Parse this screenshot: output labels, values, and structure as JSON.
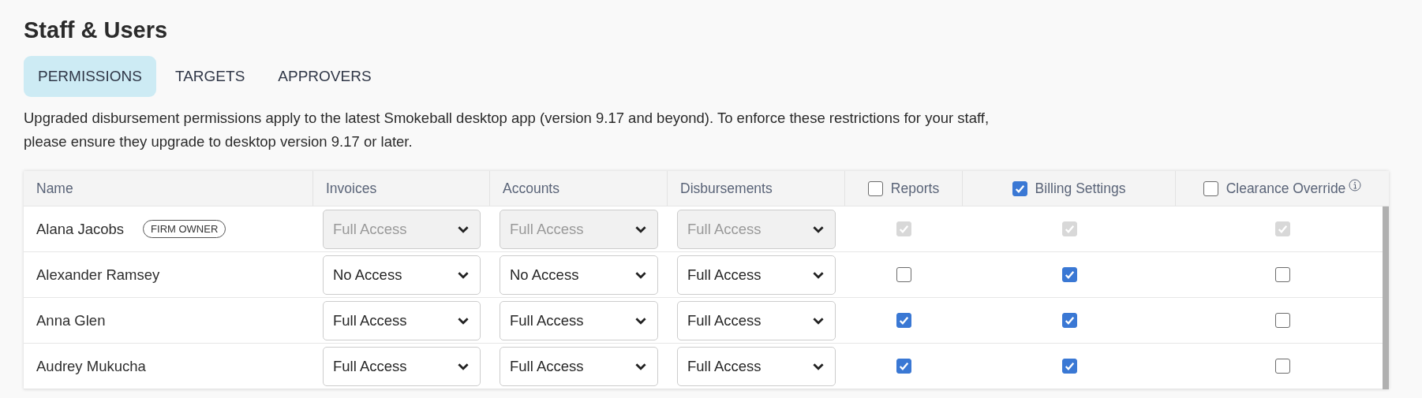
{
  "page": {
    "title": "Staff & Users"
  },
  "tabs": [
    {
      "label": "PERMISSIONS",
      "selected": true
    },
    {
      "label": "TARGETS",
      "selected": false
    },
    {
      "label": "APPROVERS",
      "selected": false
    }
  ],
  "notice": "Upgraded disbursement permissions apply to the latest Smokeball desktop app (version 9.17 and beyond). To enforce these restrictions for your staff, please ensure they upgrade to desktop version 9.17 or later.",
  "table": {
    "columns": [
      {
        "label": "Name",
        "kind": "text"
      },
      {
        "label": "Invoices",
        "kind": "select"
      },
      {
        "label": "Accounts",
        "kind": "select"
      },
      {
        "label": "Disbursements",
        "kind": "select"
      },
      {
        "label": "Reports",
        "kind": "check",
        "checked": false
      },
      {
        "label": "Billing Settings",
        "kind": "check",
        "checked": true
      },
      {
        "label": "Clearance Override",
        "kind": "check",
        "checked": false,
        "info": true
      }
    ],
    "rows": [
      {
        "name": "Alana Jacobs",
        "badge": "FIRM OWNER",
        "disabled": true,
        "invoices": "Full Access",
        "accounts": "Full Access",
        "disbursements": "Full Access",
        "reports": true,
        "billing_settings": true,
        "clearance_override": true
      },
      {
        "name": "Alexander Ramsey",
        "disabled": false,
        "invoices": "No Access",
        "accounts": "No Access",
        "disbursements": "Full Access",
        "reports": false,
        "billing_settings": true,
        "clearance_override": false
      },
      {
        "name": "Anna Glen",
        "disabled": false,
        "invoices": "Full Access",
        "accounts": "Full Access",
        "disbursements": "Full Access",
        "reports": true,
        "billing_settings": true,
        "clearance_override": false
      },
      {
        "name": "Audrey Mukucha",
        "disabled": false,
        "invoices": "Full Access",
        "accounts": "Full Access",
        "disbursements": "Full Access",
        "reports": true,
        "billing_settings": true,
        "clearance_override": false
      }
    ]
  }
}
